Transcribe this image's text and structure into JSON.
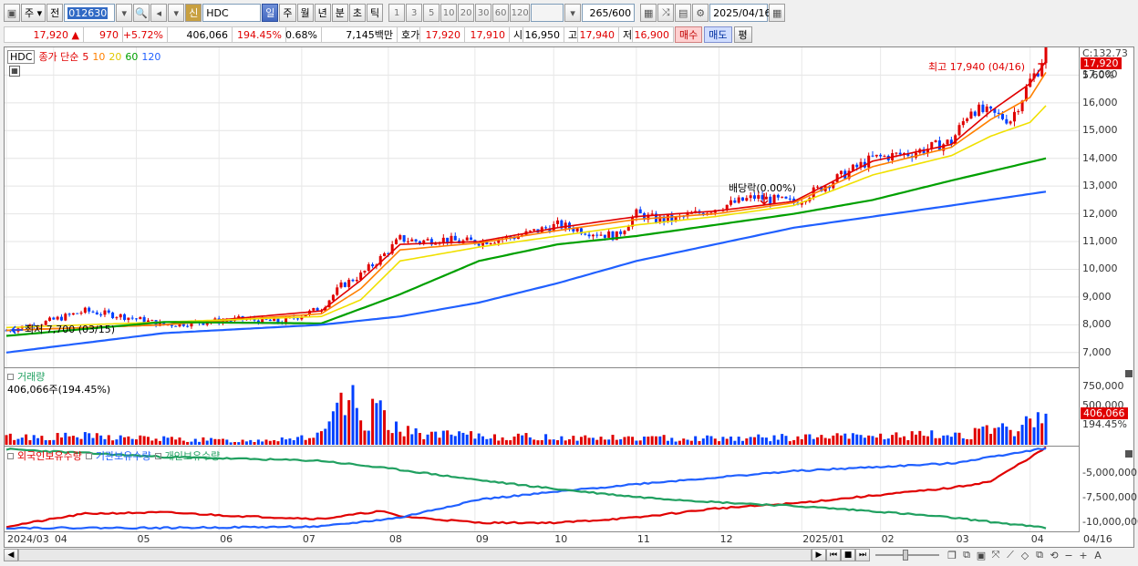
{
  "toolbar": {
    "type_label": "주",
    "jeon_label": "전",
    "stock_code": "012630",
    "stock_name": "HDC",
    "new_label": "신",
    "periods": [
      "일",
      "주",
      "월",
      "년",
      "분",
      "초",
      "틱"
    ],
    "active_period": "일",
    "intervals": [
      "1",
      "3",
      "5",
      "10",
      "20",
      "30",
      "60",
      "120"
    ],
    "count": "265",
    "count_max": "/600",
    "date": "2025/04/16"
  },
  "quote": {
    "price": "17,920",
    "change_arrow": "▲",
    "change": "970",
    "change_pct": "+5.72%",
    "volume": "406,066",
    "volume_pct": "194.45%",
    "turnover": "0.68%",
    "amount": "7,145백만",
    "hoga_label": "호가",
    "ask": "17,920",
    "bid": "17,910",
    "open_label": "시",
    "open": "16,950",
    "high_label": "고",
    "high": "17,940",
    "low_label": "저",
    "low": "16,900",
    "buy_label": "매수",
    "sell_label": "매도",
    "eval_label": "평"
  },
  "colors": {
    "up": "#e00000",
    "down": "#0040ff",
    "ma5": "#e00000",
    "ma10": "#ff8000",
    "ma20": "#f0e000",
    "ma60": "#00a000",
    "ma120": "#2060ff",
    "foreign": "#e00000",
    "institution": "#2060ff",
    "individual": "#20a060"
  },
  "price_pane": {
    "legend_name": "HDC",
    "legend_ma": "종가 단순",
    "ma_periods": [
      "5",
      "10",
      "20",
      "60",
      "120"
    ],
    "y_ticks": [
      "17,000",
      "16,000",
      "15,000",
      "14,000",
      "13,000",
      "12,000",
      "11,000",
      "10,000",
      "9,000",
      "8,000",
      "7,000"
    ],
    "c_label": "C:132.73",
    "last_price_tag": "17,920",
    "last_pct_tag": "5.60%",
    "high_annot": "최고 17,940 (04/16)",
    "low_annot": "최저 7,700 (03/15)",
    "dividend_annot": "배당락(0.00%)"
  },
  "volume_pane": {
    "title": "거래량",
    "value_label": "406,066주(194.45%)",
    "y_ticks": [
      "750,000",
      "500,000"
    ],
    "last_tag": "406,066",
    "last_pct": "194.45%"
  },
  "holding_pane": {
    "legend": [
      "외국인보유수량",
      "기관보유수량",
      "개인보유수량"
    ],
    "y_ticks": [
      "-5,000,000",
      "-7,500,000",
      "-10,000,000"
    ]
  },
  "x_labels": [
    "2024/03",
    "04",
    "05",
    "06",
    "07",
    "08",
    "09",
    "10",
    "11",
    "12",
    "2025/01",
    "02",
    "03",
    "04"
  ],
  "x_right_label": "04/16",
  "chart_data": [
    {
      "type": "line",
      "title": "HDC",
      "x_unit": "trading day index (0 = 2024/03/15, 264 = 2025/04/16)",
      "ylim": [
        6500,
        18000
      ],
      "series": [
        {
          "name": "종가",
          "x": [
            0,
            10,
            20,
            30,
            40,
            50,
            60,
            70,
            80,
            85,
            90,
            95,
            100,
            105,
            110,
            115,
            120,
            130,
            140,
            150,
            155,
            160,
            165,
            170,
            175,
            180,
            190,
            200,
            210,
            215,
            220,
            230,
            240,
            245,
            250,
            255,
            258,
            260,
            262,
            264
          ],
          "values": [
            7800,
            8100,
            8500,
            8300,
            8000,
            8100,
            8200,
            8100,
            8600,
            9400,
            9800,
            10400,
            11100,
            11000,
            11100,
            11000,
            11000,
            11200,
            11600,
            11300,
            11200,
            12000,
            11800,
            11800,
            12000,
            12200,
            12600,
            12400,
            13200,
            13600,
            14000,
            14200,
            14600,
            15800,
            15600,
            15400,
            16200,
            16800,
            17200,
            17920
          ]
        },
        {
          "name": "5",
          "x": [
            0,
            40,
            80,
            90,
            100,
            120,
            140,
            160,
            180,
            200,
            220,
            240,
            250,
            260,
            264
          ],
          "values": [
            7800,
            8000,
            8500,
            9600,
            10900,
            11000,
            11500,
            11900,
            12100,
            12450,
            13900,
            14500,
            15700,
            16700,
            17500
          ]
        },
        {
          "name": "10",
          "x": [
            0,
            40,
            80,
            90,
            100,
            120,
            140,
            160,
            180,
            200,
            220,
            240,
            250,
            260,
            264
          ],
          "values": [
            7800,
            8000,
            8400,
            9300,
            10700,
            10950,
            11400,
            11800,
            12000,
            12400,
            13700,
            14400,
            15400,
            16200,
            17100
          ]
        },
        {
          "name": "20",
          "x": [
            0,
            40,
            80,
            90,
            100,
            120,
            140,
            160,
            180,
            200,
            220,
            240,
            250,
            260,
            264
          ],
          "values": [
            7900,
            8100,
            8300,
            8900,
            10300,
            10800,
            11200,
            11600,
            11900,
            12300,
            13400,
            14100,
            14800,
            15300,
            15900
          ]
        },
        {
          "name": "60",
          "x": [
            0,
            40,
            80,
            100,
            120,
            140,
            160,
            180,
            200,
            220,
            240,
            264
          ],
          "values": [
            7600,
            8100,
            8050,
            9100,
            10300,
            10900,
            11200,
            11600,
            12000,
            12500,
            13200,
            14000
          ]
        },
        {
          "name": "120",
          "x": [
            0,
            40,
            80,
            100,
            120,
            140,
            160,
            180,
            200,
            220,
            240,
            264
          ],
          "values": [
            7000,
            7700,
            8000,
            8300,
            8800,
            9500,
            10300,
            10900,
            11500,
            11900,
            12300,
            12800
          ]
        }
      ]
    },
    {
      "type": "bar",
      "title": "거래량",
      "ylim": [
        0,
        1000000
      ],
      "x": [
        0,
        20,
        40,
        60,
        80,
        88,
        90,
        95,
        100,
        110,
        130,
        160,
        200,
        240,
        255,
        264
      ],
      "values": [
        120000,
        130000,
        90000,
        60000,
        140000,
        780000,
        300000,
        580000,
        200000,
        150000,
        120000,
        100000,
        110000,
        150000,
        230000,
        406066
      ]
    },
    {
      "type": "line",
      "title": "보유수량",
      "ylim": [
        -10500000,
        -4000000
      ],
      "series": [
        {
          "name": "외국인보유수량",
          "x": [
            0,
            20,
            40,
            60,
            80,
            95,
            100,
            120,
            140,
            160,
            180,
            200,
            220,
            240,
            250,
            264
          ],
          "values": [
            -10200000,
            -9200000,
            -9100000,
            -9400000,
            -9600000,
            -9000000,
            -9400000,
            -9900000,
            -9900000,
            -9500000,
            -8800000,
            -8400000,
            -7800000,
            -7200000,
            -6700000,
            -4100000
          ]
        },
        {
          "name": "기관보유수량",
          "x": [
            0,
            40,
            80,
            100,
            120,
            140,
            160,
            180,
            200,
            220,
            240,
            264
          ],
          "values": [
            -10300000,
            -10300000,
            -10200000,
            -9500000,
            -8100000,
            -7500000,
            -6900000,
            -6400000,
            -5900000,
            -5600000,
            -5300000,
            -4100000
          ]
        },
        {
          "name": "개인보유수량",
          "x": [
            0,
            40,
            80,
            100,
            120,
            140,
            160,
            180,
            200,
            220,
            240,
            264
          ],
          "values": [
            -4200000,
            -4800000,
            -5100000,
            -5800000,
            -6600000,
            -7300000,
            -7900000,
            -8300000,
            -8600000,
            -9000000,
            -9500000,
            -10300000
          ]
        }
      ]
    }
  ]
}
